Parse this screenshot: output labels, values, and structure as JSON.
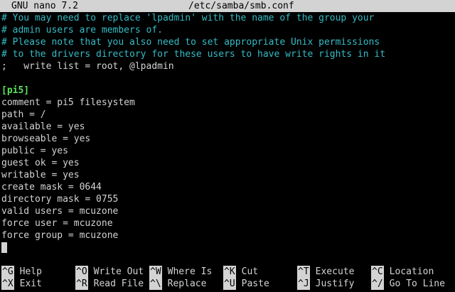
{
  "header": {
    "app": "GNU nano 7.2",
    "file": "/etc/samba/smb.conf"
  },
  "editor": {
    "lines": [
      {
        "type": "comment",
        "text": "# You may need to replace 'lpadmin' with the name of the group your"
      },
      {
        "type": "comment",
        "text": "# admin users are members of."
      },
      {
        "type": "comment",
        "text": "# Please note that you also need to set appropriate Unix permissions"
      },
      {
        "type": "comment",
        "text": "# to the drivers directory for these users to have write rights in it"
      },
      {
        "type": "plain",
        "text": ";   write list = root, @lpadmin"
      },
      {
        "type": "blank",
        "text": ""
      },
      {
        "type": "section",
        "text": "[pi5]"
      },
      {
        "type": "plain",
        "text": "comment = pi5 filesystem"
      },
      {
        "type": "plain",
        "text": "path = /"
      },
      {
        "type": "plain",
        "text": "available = yes"
      },
      {
        "type": "plain",
        "text": "browseable = yes"
      },
      {
        "type": "plain",
        "text": "public = yes"
      },
      {
        "type": "plain",
        "text": "guest ok = yes"
      },
      {
        "type": "plain",
        "text": "writable = yes"
      },
      {
        "type": "plain",
        "text": "create mask = 0644"
      },
      {
        "type": "plain",
        "text": "directory mask = 0755"
      },
      {
        "type": "plain",
        "text": "valid users = mcuzone"
      },
      {
        "type": "plain",
        "text": "force user = mcuzone"
      },
      {
        "type": "plain",
        "text": "force group = mcuzone"
      }
    ]
  },
  "shortcuts": {
    "row1": [
      {
        "key": "^G",
        "label": "Help"
      },
      {
        "key": "^O",
        "label": "Write Out"
      },
      {
        "key": "^W",
        "label": "Where Is"
      },
      {
        "key": "^K",
        "label": "Cut"
      },
      {
        "key": "^T",
        "label": "Execute"
      },
      {
        "key": "^C",
        "label": "Location"
      }
    ],
    "row2": [
      {
        "key": "^X",
        "label": "Exit"
      },
      {
        "key": "^R",
        "label": "Read File"
      },
      {
        "key": "^\\",
        "label": "Replace"
      },
      {
        "key": "^U",
        "label": "Paste"
      },
      {
        "key": "^J",
        "label": "Justify"
      },
      {
        "key": "^/",
        "label": "Go To Line"
      }
    ]
  },
  "colors": {
    "title_bar_bg": "#d3d3d3",
    "comment": "#35bcc6",
    "section": "#5ee35e",
    "text": "#d3d3d3",
    "background": "#000000"
  }
}
